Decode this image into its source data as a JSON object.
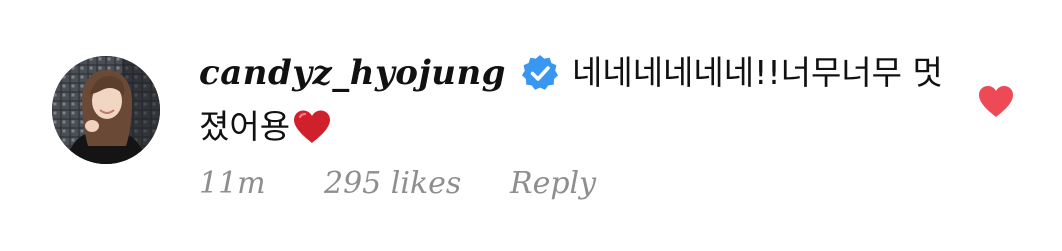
{
  "comment": {
    "username": "candyz_hyojung",
    "verified": true,
    "text_line1": "네네네네네네!!너무너무 멋",
    "text_line2": "졌어용",
    "emoji": "red-heart",
    "time": "11m",
    "likes": "295 likes",
    "reply_label": "Reply",
    "liked": true,
    "like_icon": "heart-icon"
  },
  "colors": {
    "verified_badge": "#3897f0",
    "heart": "#ed4956",
    "meta_text": "#8e8e8e",
    "text": "#111111"
  }
}
